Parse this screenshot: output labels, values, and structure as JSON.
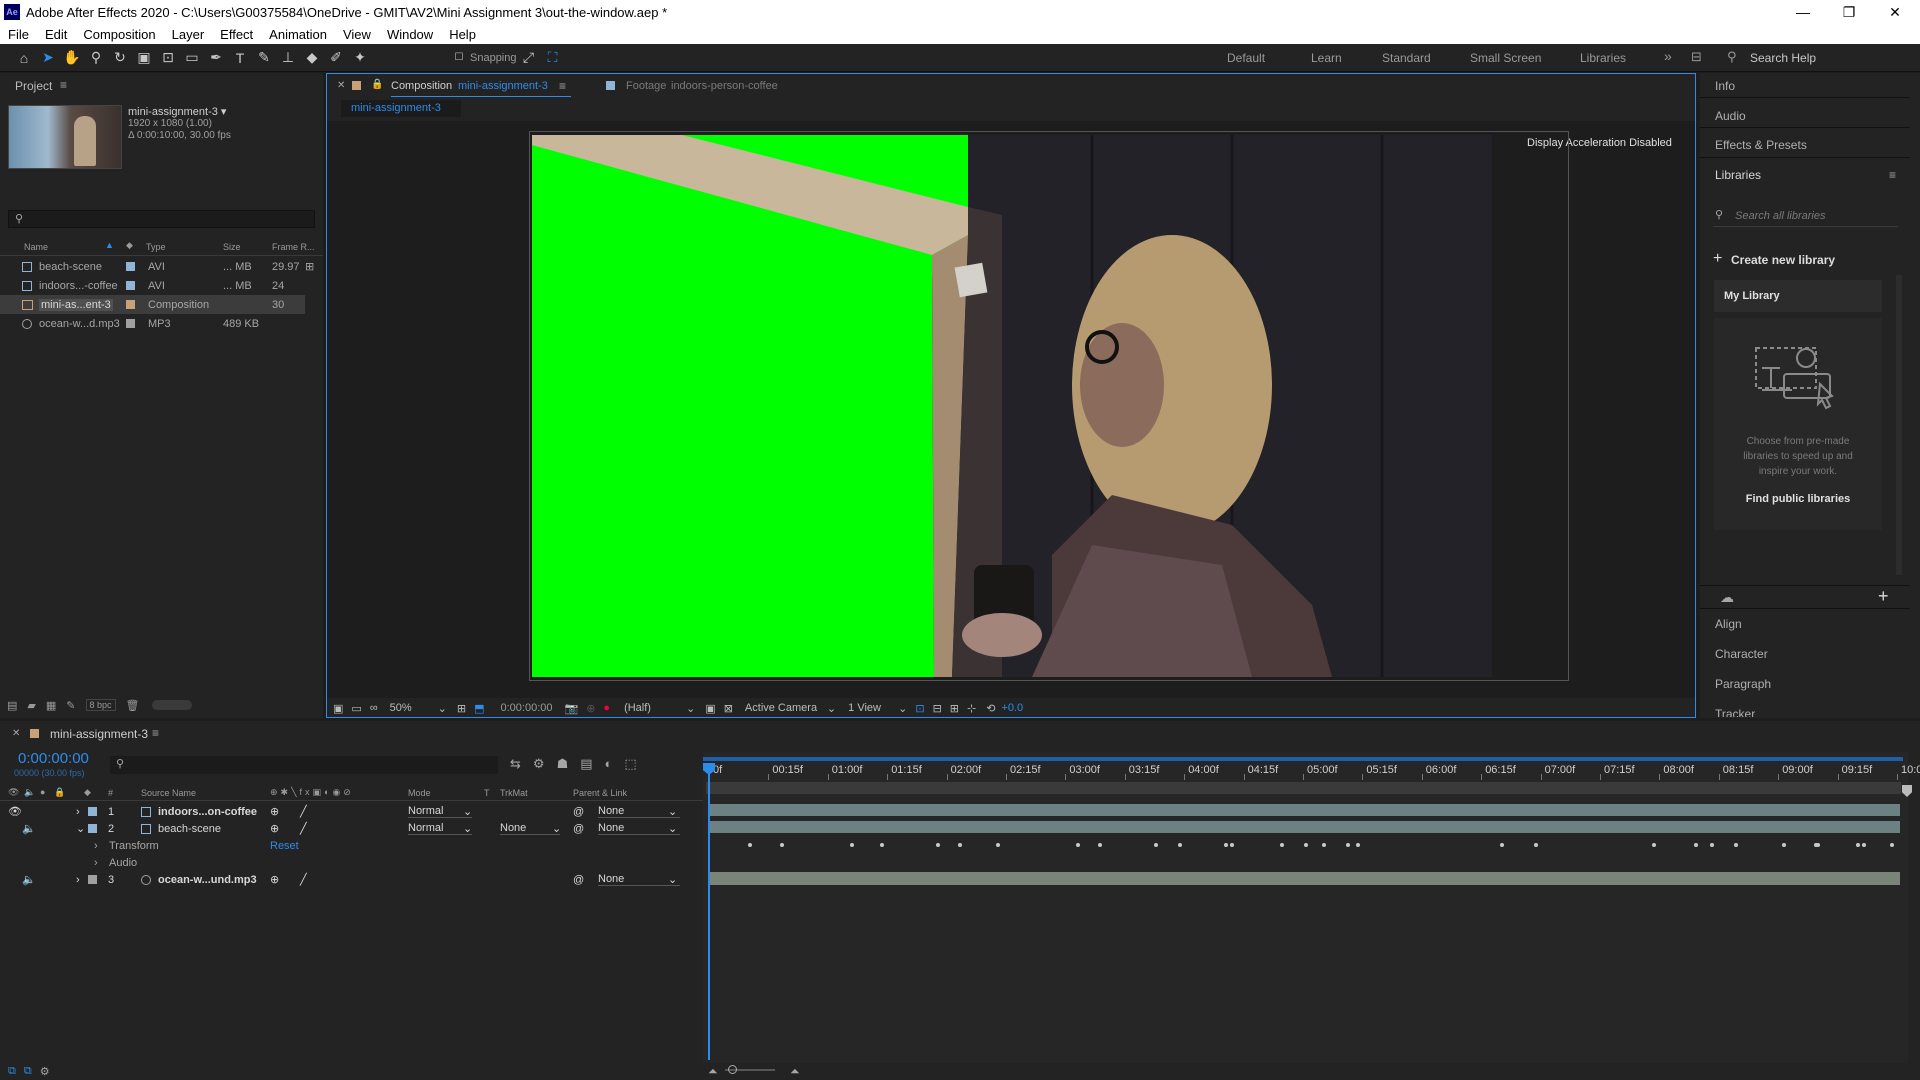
{
  "app": {
    "title": "Adobe After Effects 2020 - C:\\Users\\G00375584\\OneDrive - GMIT\\AV2\\Mini Assignment 3\\out-the-window.aep *",
    "logo": "Ae"
  },
  "window_controls": {
    "minimize": "—",
    "maximize": "❐",
    "close": "✕"
  },
  "menu": [
    "File",
    "Edit",
    "Composition",
    "Layer",
    "Effect",
    "Animation",
    "View",
    "Window",
    "Help"
  ],
  "toolbar": {
    "snapping": "Snapping",
    "workspaces": [
      "Default",
      "Learn",
      "Standard",
      "Small Screen",
      "Libraries"
    ],
    "overflow": "»",
    "search_placeholder": "Search Help"
  },
  "project": {
    "title": "Project",
    "menu_icon": "≡",
    "selected_name": "mini-assignment-3 ▾",
    "selected_info1": "1920 x 1080 (1.00)",
    "selected_info2": "Δ 0:00:10:00, 30.00 fps",
    "columns": {
      "name": "Name",
      "type": "Type",
      "size": "Size",
      "frame_rate": "Frame R..."
    },
    "items": [
      {
        "name": "beach-scene",
        "type": "AVI",
        "size": "... MB",
        "fps": "29.97",
        "color": "#8fb4d6"
      },
      {
        "name": "indoors...-coffee",
        "type": "AVI",
        "size": "... MB",
        "fps": "24",
        "color": "#8fb4d6"
      },
      {
        "name": "mini-as...ent-3",
        "type": "Composition",
        "size": "",
        "fps": "30",
        "color": "#c8a07a"
      },
      {
        "name": "ocean-w...d.mp3",
        "type": "MP3",
        "size": "489 KB",
        "fps": "",
        "color": "#a0a0a0"
      }
    ],
    "bpc": "8 bpc"
  },
  "viewer": {
    "tab_comp_prefix": "Composition",
    "tab_comp_name": "mini-assignment-3",
    "tab_footage_prefix": "Footage",
    "tab_footage_name": "indoors-person-coffee",
    "breadcrumb": "mini-assignment-3",
    "notice": "Display Acceleration Disabled",
    "controls": {
      "zoom": "50%",
      "timecode": "0:00:00:00",
      "resolution": "(Half)",
      "camera": "Active Camera",
      "views": "1 View",
      "exposure": "+0.0"
    }
  },
  "right_panel": {
    "items": [
      "Info",
      "Audio",
      "Effects & Presets"
    ],
    "libraries_title": "Libraries",
    "libraries_search": "Search all libraries",
    "create": "Create new library",
    "my_library": "My Library",
    "promo": "Choose from pre-made libraries to speed up and inspire your work.",
    "find": "Find public libraries",
    "lower_items": [
      "Align",
      "Character",
      "Paragraph",
      "Tracker"
    ]
  },
  "timeline": {
    "tab": "mini-assignment-3",
    "timecode": "0:00:00:00",
    "timecode_sub": "00000 (30.00 fps)",
    "columns": {
      "source": "Source Name",
      "mode": "Mode",
      "t": "T",
      "trkmat": "TrkMat",
      "parent": "Parent & Link"
    },
    "ruler": [
      "0f",
      "00:15f",
      "01:00f",
      "01:15f",
      "02:00f",
      "02:15f",
      "03:00f",
      "03:15f",
      "04:00f",
      "04:15f",
      "05:00f",
      "05:15f",
      "06:00f",
      "06:15f",
      "07:00f",
      "07:15f",
      "08:00f",
      "08:15f",
      "09:00f",
      "09:15f",
      "10:0"
    ],
    "layers": [
      {
        "num": "1",
        "name": "indoors...on-coffee",
        "mode": "Normal",
        "trkmat": "",
        "parent": "None",
        "color": "#8fb4d6"
      },
      {
        "num": "2",
        "name": "beach-scene",
        "mode": "Normal",
        "trkmat": "None",
        "parent": "None",
        "color": "#8fb4d6"
      },
      {
        "num": "3",
        "name": "ocean-w...und.mp3",
        "mode": "",
        "trkmat": "",
        "parent": "None",
        "color": "#a0a0a0"
      }
    ],
    "transform": "Transform",
    "reset": "Reset",
    "audio": "Audio"
  }
}
